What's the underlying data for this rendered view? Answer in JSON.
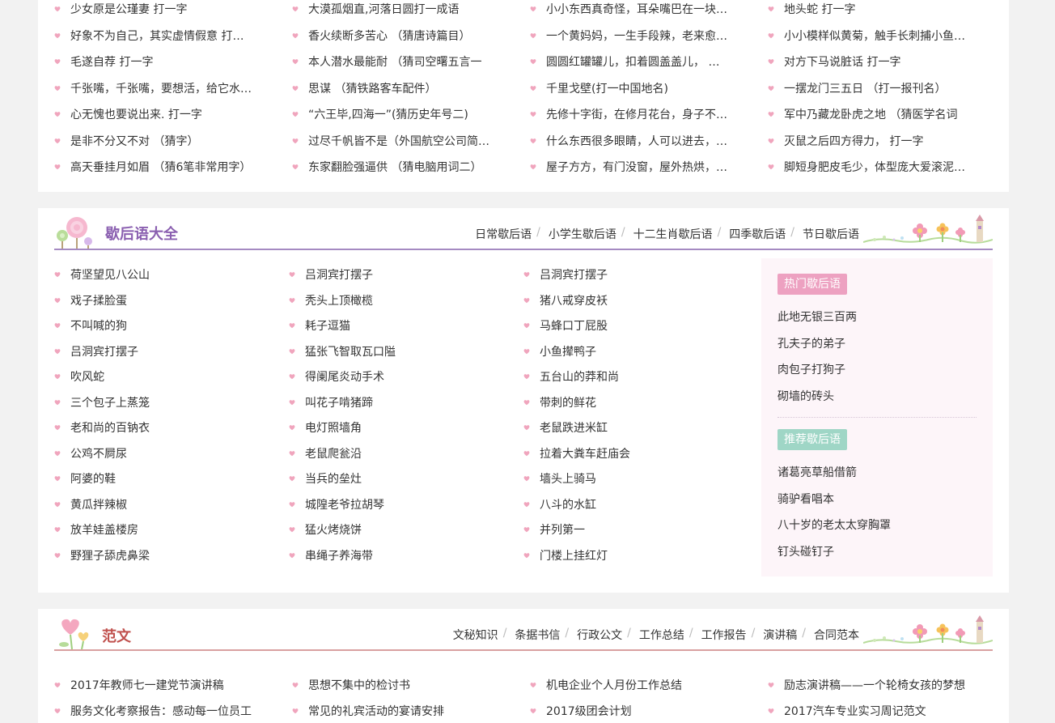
{
  "riddles": {
    "columns": [
      [
        "少女原是公瑾妻 打一字",
        "好象不为自己，其实虚情假意 打一字",
        "毛遂自荐 打一字",
        "千张嘴，千张嘴，要想活，给它水。 …",
        "心无愧也要说出来. 打一字",
        "是非不分又不对 （猜字）",
        "高天垂挂月如眉 （猜6笔非常用字）"
      ],
      [
        "大漠孤烟直,河落日圆打一成语",
        "香火续断多苦心 （猜唐诗篇目）",
        "本人潜水最能耐 （猜司空曙五言一",
        "思谋 （猜铁路客车配件）",
        "“六王毕,四海一”(猜历史年号二)",
        "过尽千帆皆不是（外国航空公司简称）",
        "东家翻脸强逼供 （猜电脑用词二）"
      ],
      [
        "小小东西真奇怪，耳朵嘴巴在一块，二人",
        "一个黄妈妈，一生手段辣，老来愈厉害…",
        "圆圆红罐罐儿，扣着圆盖盖儿， 甜甜的",
        "千里戈壁(打一中国地名)",
        "先修十字街，在修月花台，身子不用动…",
        "什么东西很多眼睛，人可以进去，动物不",
        "屋子方方，有门没窗，屋外热烘，屋里…"
      ],
      [
        "地头蛇 打一字",
        "小小模样似黄菊，触手长刺捕小鱼。 （",
        "对方下马说脏话 打一字",
        "一摆龙门三五日 （打一报刊名）",
        "军中乃藏龙卧虎之地 （猜医学名词",
        "灭鼠之后四方得力， 打一字",
        "脚短身肥皮毛少，体型庞大爱滚泥。（"
      ]
    ]
  },
  "xiehouyu": {
    "title": "歇后语大全",
    "nav": [
      "日常歇后语",
      "小学生歇后语",
      "十二生肖歇后语",
      "四季歇后语",
      "节日歇后语"
    ],
    "columns": [
      [
        "荷坚望见八公山",
        "戏子揉脸蛋",
        "不叫喊的狗",
        "吕洞宾打摆子",
        "吹风蛇",
        "三个包子上蒸笼",
        "老和尚的百钠衣",
        "公鸡不屙尿",
        "阿婆的鞋",
        "黄瓜拌辣椒",
        "放羊娃盖楼房",
        "野狸子舔虎鼻梁"
      ],
      [
        "吕洞宾打摆子",
        "秃头上顶橄榄",
        "耗子逗猫",
        "猛张飞智取瓦口隘",
        "得阑尾炎动手术",
        "叫花子啃猪蹄",
        "电灯照墙角",
        "老鼠爬瓮沿",
        "当兵的垒灶",
        "城隍老爷拉胡琴",
        "猛火烤烧饼",
        "串绳子养海带"
      ],
      [
        "吕洞宾打摆子",
        "猪八戒穿皮袄",
        "马蜂口丁屁股",
        "小鱼撵鸭子",
        "五台山的莽和尚",
        "带刺的鲜花",
        "老鼠跌进米缸",
        "拉着大粪车赶庙会",
        "墙头上骑马",
        "八斗的水缸",
        "并列第一",
        "门楼上挂红灯"
      ]
    ],
    "hot_tag": "热门歇后语",
    "hot": [
      "此地无银三百两",
      "孔夫子的弟子",
      "肉包子打狗子",
      "砌墙的砖头"
    ],
    "rec_tag": "推荐歇后语",
    "rec": [
      "诸葛亮草船借箭",
      "骑驴看唱本",
      "八十岁的老太太穿胸罩",
      "钉头碰钉子"
    ]
  },
  "fanwen": {
    "title": "范文",
    "nav": [
      "文秘知识",
      "条据书信",
      "行政公文",
      "工作总结",
      "工作报告",
      "演讲稿",
      "合同范本"
    ],
    "columns": [
      [
        "2017年教师七一建党节演讲稿",
        "服务文化考察报告：感动每一位员工"
      ],
      [
        "思想不集中的检讨书",
        "常见的礼宾活动的宴请安排"
      ],
      [
        "机电企业个人月份工作总结",
        "2017级团会计划"
      ],
      [
        "励志演讲稿——一个轮椅女孩的梦想",
        "2017汽车专业实习周记范文"
      ]
    ]
  },
  "colors": {
    "purple_title": "#8a5fb0",
    "purple_line": "#a58ac2",
    "red_title": "#c0504d",
    "red_line": "#d9a0a0",
    "heart": "#f0a5bd",
    "hot_tag": "#eda1c1",
    "rec_tag": "#9fd6c6"
  },
  "icons": [
    "heart-bullet-icon",
    "lollipop-logo-icon",
    "heart-flower-logo-icon",
    "flower-garden-decoration-icon"
  ]
}
